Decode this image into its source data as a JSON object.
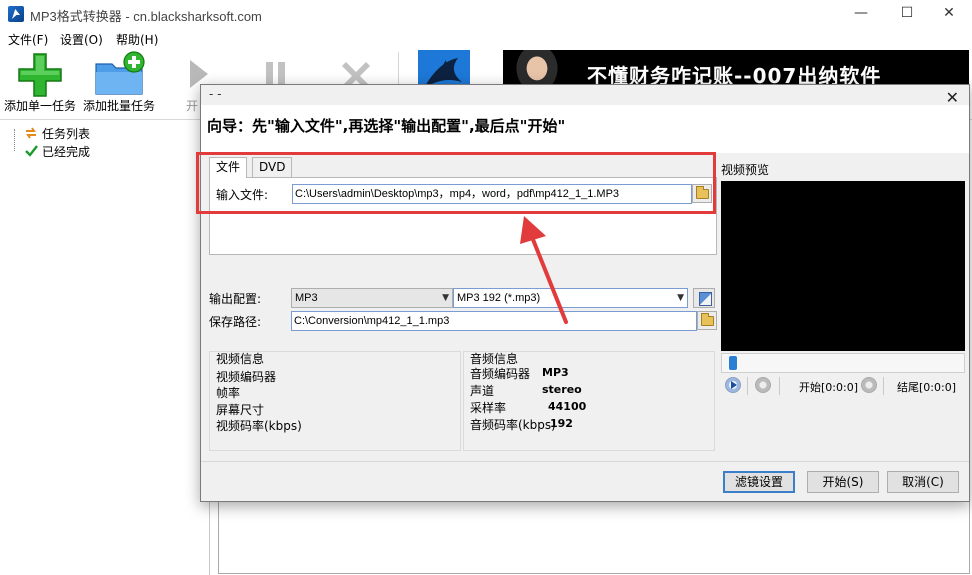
{
  "app": {
    "title": "MP3格式转换器 - cn.blacksharksoft.com",
    "window_controls": {
      "minimize": "—",
      "maximize": "☐",
      "close": "✕"
    }
  },
  "menu": [
    "文件(F)",
    "设置(O)",
    "帮助(H)"
  ],
  "toolbar": {
    "add_single": "添加单一任务",
    "add_batch": "添加批量任务",
    "start_partial": "开"
  },
  "ad": {
    "text": "不懂财务咋记账--007出纳软件"
  },
  "tree": {
    "task_list": "任务列表",
    "done": "已经完成"
  },
  "dialog": {
    "title": "- -",
    "close": "✕",
    "guide": "向导：先\"输入文件\",再选择\"输出配置\",最后点\"开始\"",
    "tabs": [
      "文件",
      "DVD"
    ],
    "input_label": "输入文件:",
    "input_value": "C:\\Users\\admin\\Desktop\\mp3，mp4，word，pdf\\mp412_1_1.MP3",
    "output_label": "输出配置:",
    "output_format": "MP3",
    "output_profile": "MP3 192 (*.mp3)",
    "save_label": "保存路径:",
    "save_value": "C:\\Conversion\\mp412_1_1.mp3",
    "video_info": {
      "heading": "视频信息",
      "codec": "视频编码器",
      "fps": "帧率",
      "size": "屏幕尺寸",
      "bitrate": "视频码率(kbps)"
    },
    "audio_info": {
      "heading": "音频信息",
      "codec_label": "音频编码器",
      "codec_value": "MP3",
      "channel_label": "声道",
      "channel_value": "stereo",
      "rate_label": "采样率",
      "rate_value": "44100",
      "bitrate_label": "音频码率(kbps)",
      "bitrate_value": "192"
    },
    "preview": {
      "label": "视频预览",
      "start": "开始[0:0:0]",
      "end": "结尾[0:0:0]"
    },
    "buttons": {
      "filter": "滤镜设置",
      "start": "开始(S)",
      "cancel": "取消(C)"
    }
  },
  "colors": {
    "highlight": "#e23b3b",
    "accent": "#3c7fc9"
  }
}
